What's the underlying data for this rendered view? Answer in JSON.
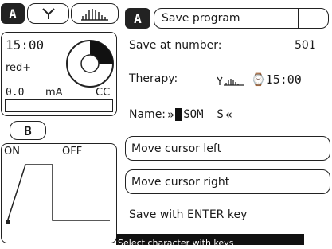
{
  "left_panel": {
    "tab_a_label": "A",
    "tab_b_label": "B",
    "time": "15:00",
    "program_name": "red+",
    "current_value": "0.0",
    "current_unit": "mA",
    "mode": "CC",
    "timer_fraction_filled": 0.25,
    "graph": {
      "on_label": "ON",
      "off_label": "OFF"
    }
  },
  "header": {
    "channel_badge": "A",
    "title": "Save program"
  },
  "content": {
    "save_at_label": "Save at number:",
    "save_at_value": "501",
    "therapy_label": "Therapy:",
    "therapy_time": "⌚15:00",
    "name_label": "Name:",
    "name_prefix": "»",
    "name_cursor_char": " ",
    "name_value": "SOM  S",
    "name_suffix": "«",
    "hint_enter": "Save with ENTER key"
  },
  "buttons": {
    "move_left": "Move cursor left",
    "move_right": "Move cursor right"
  },
  "status_bar": {
    "text": "Select character with keys"
  },
  "icons": {
    "waveform_icon": "waveform-icon",
    "bars_icon": "bar-graph-icon",
    "timer_icon": "timer-icon"
  }
}
